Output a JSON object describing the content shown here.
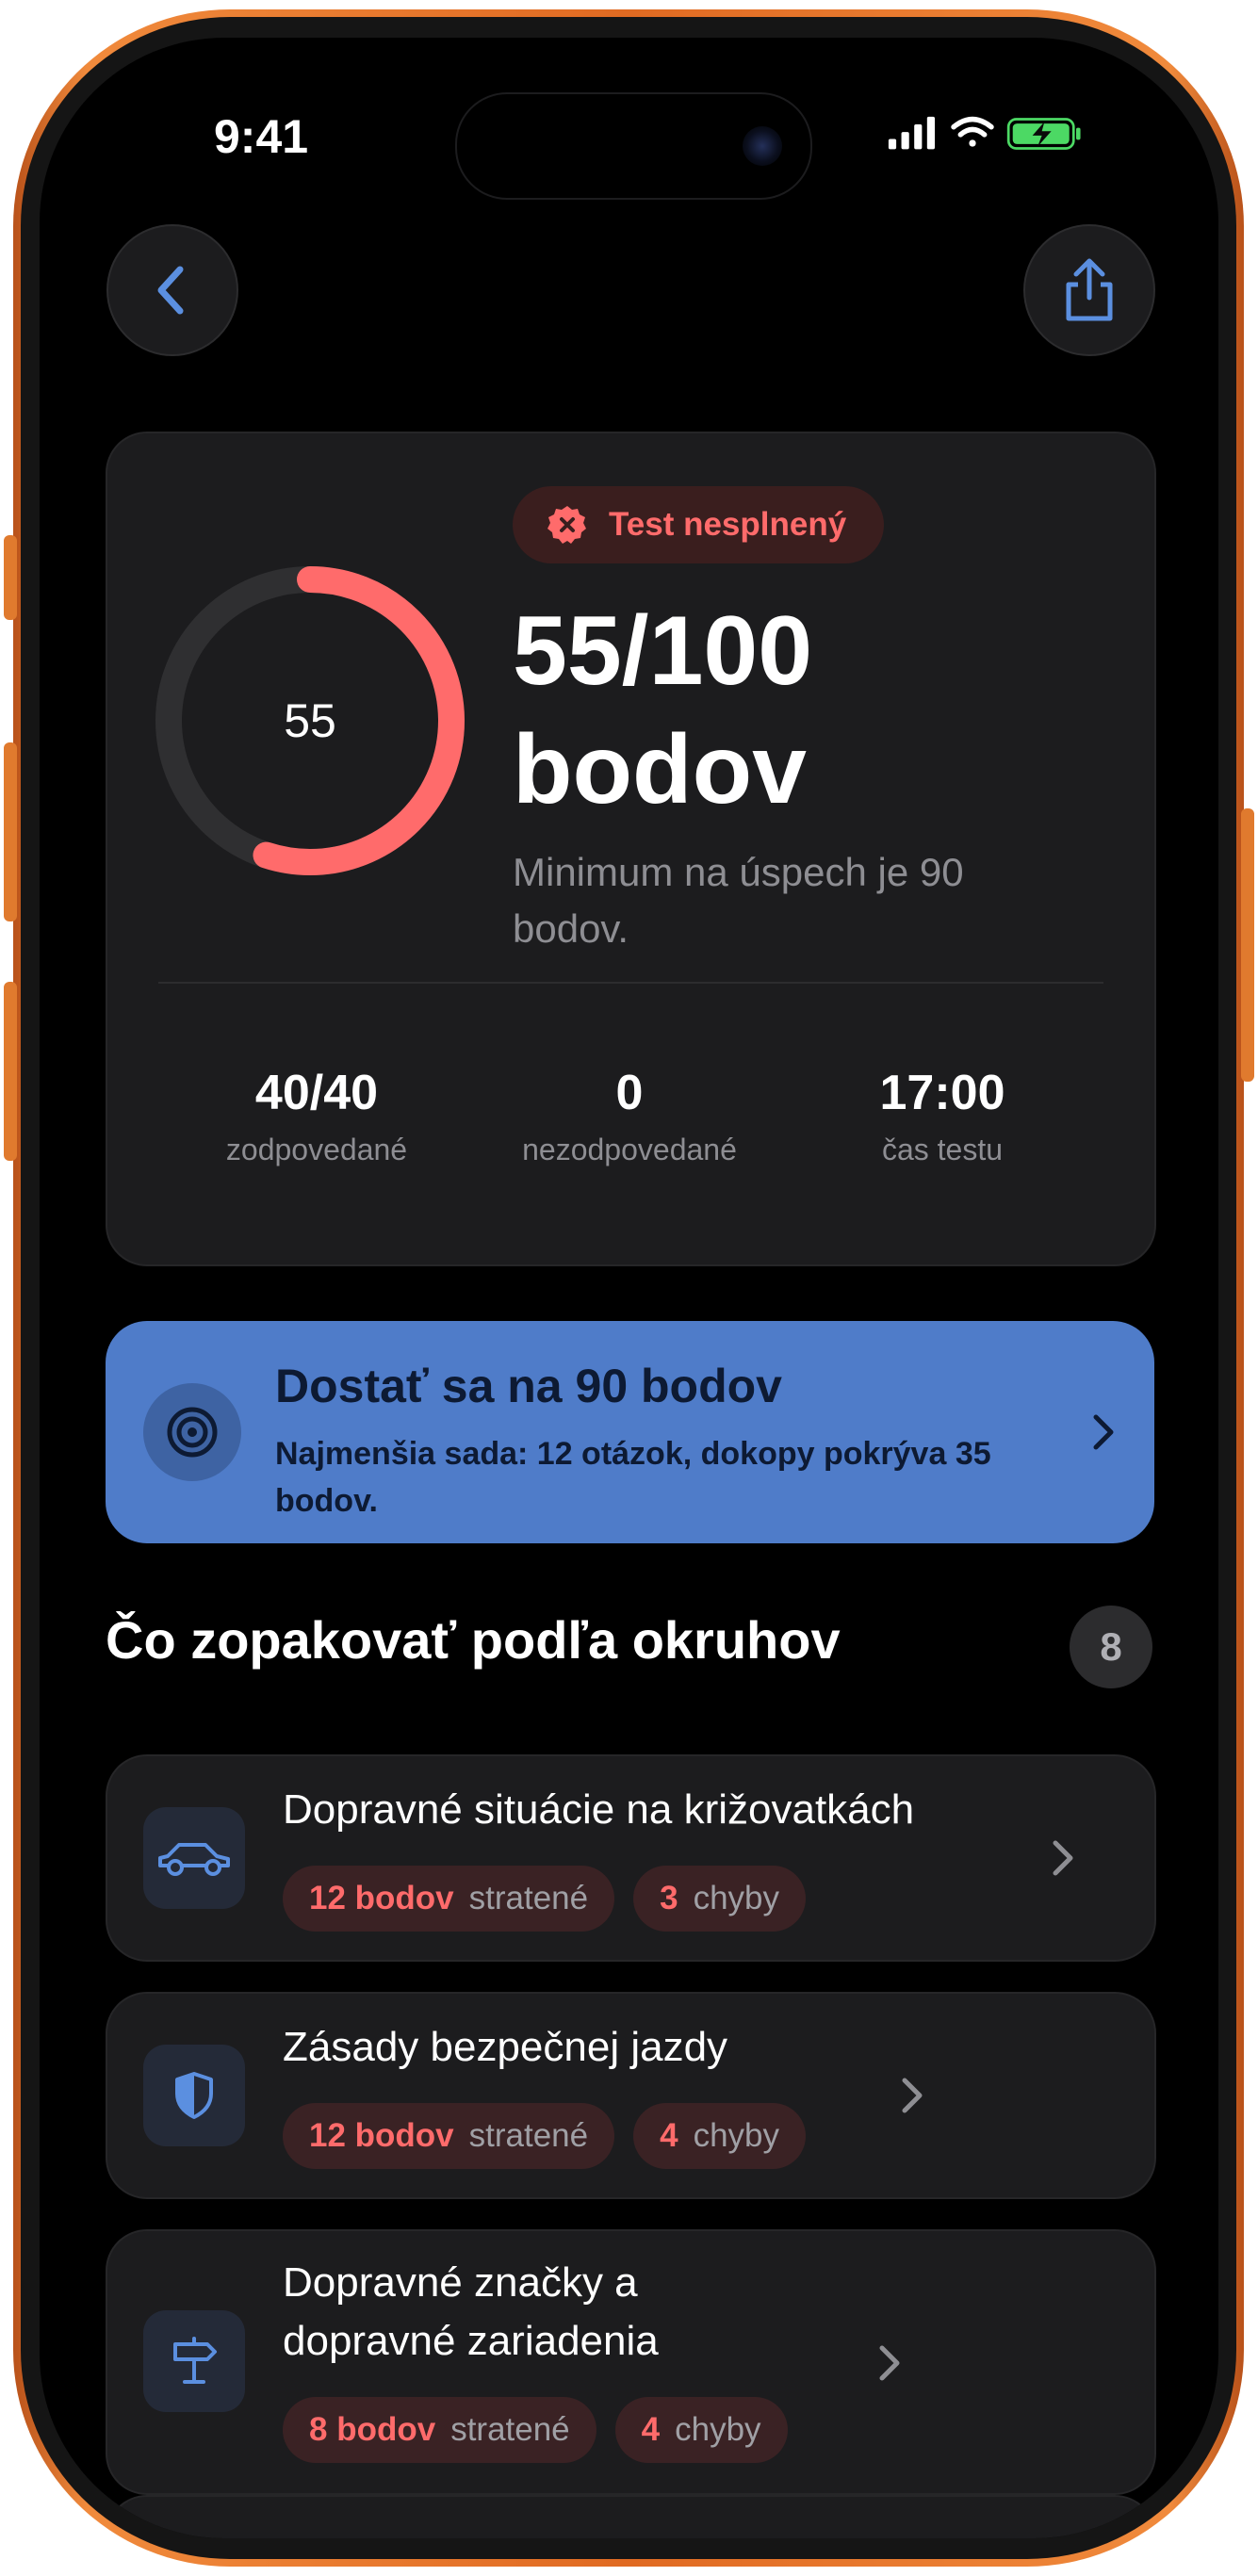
{
  "status_bar": {
    "time": "9:41"
  },
  "result": {
    "badge": "Test nesplnený",
    "score": 55,
    "max": 100,
    "gauge_label": "55",
    "score_line1": "55/100",
    "score_line2": "bodov",
    "min_text": "Minimum na úspech je 90 bodov.",
    "stats": [
      {
        "value": "40/40",
        "label": "zodpovedané"
      },
      {
        "value": "0",
        "label": "nezodpovedané"
      },
      {
        "value": "17:00",
        "label": "čas testu"
      }
    ]
  },
  "goal": {
    "title": "Dostať sa na 90 bodov",
    "subtitle": "Najmenšia sada: 12 otázok, dokopy pokrýva 35 bodov."
  },
  "section": {
    "title": "Čo zopakovať podľa okruhov",
    "count": "8"
  },
  "topics": [
    {
      "title": "Dopravné situácie na križovatkách",
      "icon": "car-icon",
      "points": "12 bodov",
      "points_label": "stratené",
      "errors": "3",
      "errors_label": "chyby"
    },
    {
      "title": "Zásady bezpečnej jazdy",
      "icon": "shield-icon",
      "points": "12 bodov",
      "points_label": "stratené",
      "errors": "4",
      "errors_label": "chyby"
    },
    {
      "title": "Dopravné značky a dopravné zariadenia",
      "icon": "signpost-icon",
      "points": "8 bodov",
      "points_label": "stratené",
      "errors": "4",
      "errors_label": "chyby"
    }
  ],
  "colors": {
    "accent_red": "#ff6b6b",
    "accent_blue": "#4f7cc9",
    "card_bg": "#1c1c1e",
    "frame_orange": "#e06a22"
  }
}
